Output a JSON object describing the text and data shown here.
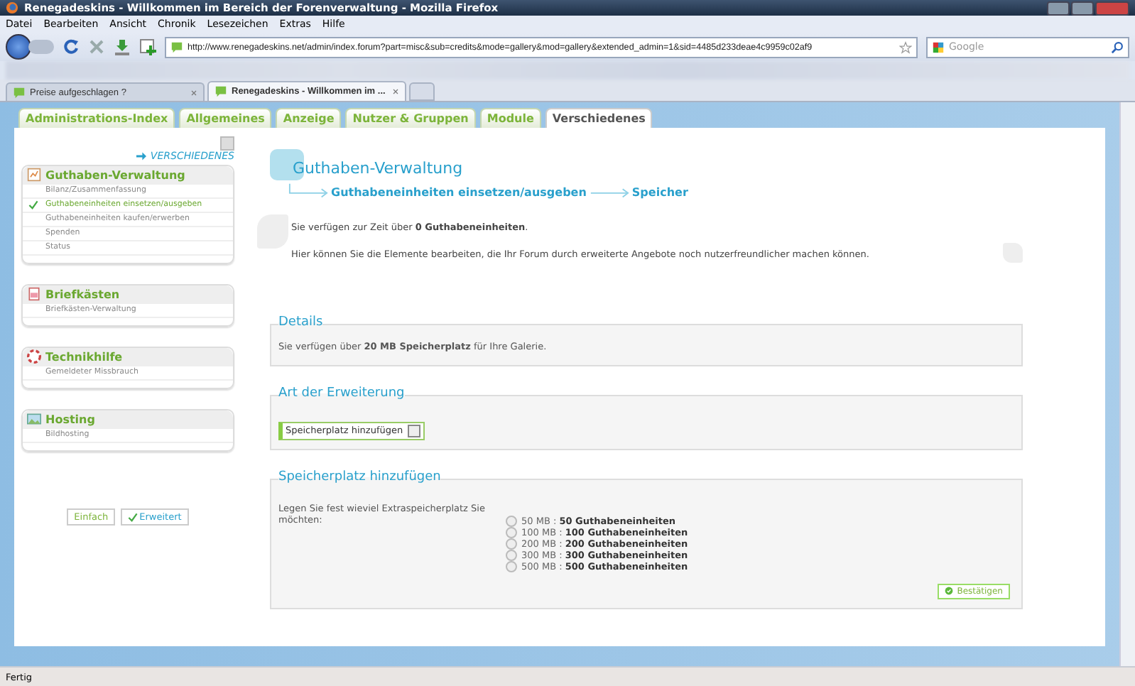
{
  "window": {
    "title": "Renegadeskins - Willkommen im Bereich der Forenverwaltung - Mozilla Firefox"
  },
  "menu": [
    "Datei",
    "Bearbeiten",
    "Ansicht",
    "Chronik",
    "Lesezeichen",
    "Extras",
    "Hilfe"
  ],
  "toolbar": {
    "url": "http://www.renegadeskins.net/admin/index.forum?part=misc&sub=credits&mode=gallery&mod=gallery&extended_admin=1&sid=4485d233deae4c9959c02af9",
    "search_placeholder": "Google"
  },
  "browser_tabs": [
    {
      "label": "Preise aufgeschlagen ?",
      "selected": false
    },
    {
      "label": "Renegadeskins - Willkommen im ...",
      "selected": true
    }
  ],
  "admin_tabs": [
    {
      "label": "Administrations-Index",
      "selected": false
    },
    {
      "label": "Allgemeines",
      "selected": false
    },
    {
      "label": "Anzeige",
      "selected": false
    },
    {
      "label": "Nutzer & Gruppen",
      "selected": false
    },
    {
      "label": "Module",
      "selected": false
    },
    {
      "label": "Verschiedenes",
      "selected": true
    }
  ],
  "sidebar": {
    "section": "VERSCHIEDENES",
    "groups": [
      {
        "title": "Guthaben-Verwaltung",
        "kind": "credits",
        "items": [
          {
            "label": "Bilanz/Zusammenfassung",
            "selected": false
          },
          {
            "label": "Guthabeneinheiten einsetzen/ausgeben",
            "selected": true
          },
          {
            "label": "Guthabeneinheiten kaufen/erwerben",
            "selected": false
          },
          {
            "label": "Spenden",
            "selected": false
          },
          {
            "label": "Status",
            "selected": false
          }
        ]
      },
      {
        "title": "Briefkästen",
        "kind": "mail",
        "items": [
          {
            "label": "Briefkästen-Verwaltung",
            "selected": false
          }
        ]
      },
      {
        "title": "Technikhilfe",
        "kind": "help",
        "items": [
          {
            "label": "Gemeldeter Missbrauch",
            "selected": false
          }
        ]
      },
      {
        "title": "Hosting",
        "kind": "hosting",
        "items": [
          {
            "label": "Bildhosting",
            "selected": false
          }
        ]
      }
    ],
    "view_buttons": [
      {
        "label": "Einfach",
        "selected": false
      },
      {
        "label": "Erweitert",
        "selected": true
      }
    ]
  },
  "main": {
    "title": "Guthaben-Verwaltung",
    "breadcrumb": [
      "Guthabeneinheiten einsetzen/ausgeben",
      "Speicher"
    ],
    "intro": [
      "Sie verfügen zur Zeit über **0 Guthabeneinheiten**.",
      "Hier können Sie die Elemente bearbeiten, die Ihr Forum durch erweiterte Angebote noch nutzerfreundlicher machen können."
    ],
    "details": {
      "legend": "Details",
      "text": "Sie verfügen über **20 MB Speicherplatz** für Ihre Galerie."
    },
    "extension": {
      "legend": "Art der Erweiterung",
      "value": "Speicherplatz hinzufügen"
    },
    "storage": {
      "legend": "Speicherplatz hinzufügen",
      "prompt": "Legen Sie fest wieviel Extraspeicherplatz Sie möchten:",
      "options": [
        {
          "label": "50 MB : **50 Guthabeneinheiten**",
          "selected": false
        },
        {
          "label": "100 MB : **100 Guthabeneinheiten**",
          "selected": false
        },
        {
          "label": "200 MB : **200 Guthabeneinheiten**",
          "selected": false
        },
        {
          "label": "300 MB : **300 Guthabeneinheiten**",
          "selected": false
        },
        {
          "label": "500 MB : **500 Guthabeneinheiten**",
          "selected": false
        }
      ],
      "confirm": "Bestätigen"
    }
  },
  "status_bar": "Fertig"
}
